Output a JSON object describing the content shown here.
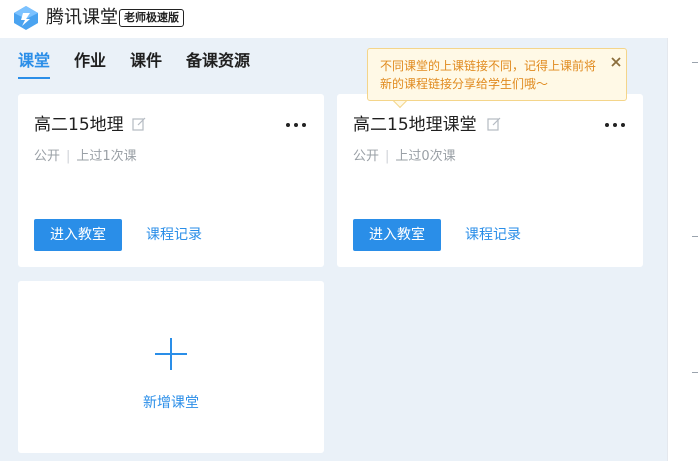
{
  "app": {
    "name": "腾讯课堂",
    "edition_badge": "老师极速版",
    "logo_icon": "tencent-classroom-logo"
  },
  "nav": {
    "tabs": [
      {
        "label": "课堂",
        "active": true
      },
      {
        "label": "作业",
        "active": false
      },
      {
        "label": "课件",
        "active": false
      },
      {
        "label": "备课资源",
        "active": false
      }
    ]
  },
  "tooltip": {
    "text": "不同课堂的上课链接不同，记得上课前将新的课程链接分享给学生们哦～",
    "close_icon": "close-icon"
  },
  "classes": [
    {
      "title": "高二15地理",
      "status": "公开",
      "sessions": "上过1次课",
      "enter_label": "进入教室",
      "record_label": "课程记录"
    },
    {
      "title": "高二15地理课堂",
      "status": "公开",
      "sessions": "上过0次课",
      "enter_label": "进入教室",
      "record_label": "课程记录"
    }
  ],
  "add_class": {
    "label": "新增课堂",
    "icon": "plus-icon"
  },
  "colors": {
    "accent": "#2a8ee8",
    "tooltip_bg": "#fff9e6",
    "tooltip_text": "#e08a1e",
    "page_bg": "#eaf1f8"
  }
}
